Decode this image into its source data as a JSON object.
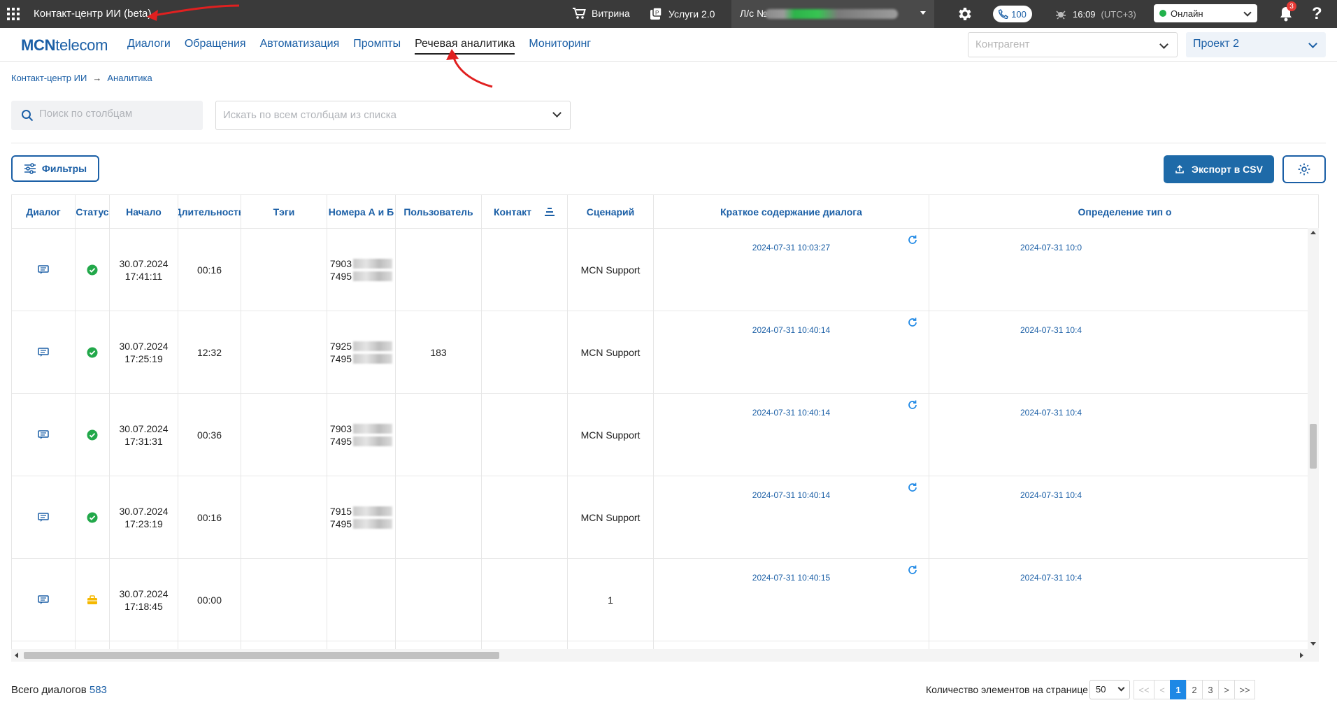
{
  "topbar": {
    "app_title": "Контакт-центр ИИ (beta)",
    "vitrina": "Витрина",
    "services": "Услуги 2.0",
    "account_label": "Л/с №",
    "calls_count": "100",
    "time": "16:09",
    "timezone": "(UTC+3)",
    "status": "Онлайн",
    "notifications": "3",
    "help": "?"
  },
  "nav": {
    "logo_bold": "MCN",
    "logo_rest": "telecom",
    "tabs": [
      "Диалоги",
      "Обращения",
      "Автоматизация",
      "Промпты",
      "Речевая аналитика",
      "Мониторинг"
    ],
    "active_tab": "Речевая аналитика",
    "contragent_placeholder": "Контрагент",
    "project": "Проект 2"
  },
  "breadcrumb": [
    "Контакт-центр ИИ",
    "Аналитика"
  ],
  "search": {
    "placeholder": "Поиск по столбцам",
    "all_columns_placeholder": "Искать по всем столбцам из списка"
  },
  "actions": {
    "filters": "Фильтры",
    "export": "Экспорт в CSV"
  },
  "table": {
    "columns": [
      "Диалог",
      "Статус",
      "Начало",
      "Длительность",
      "Тэги",
      "Номера А и Б",
      "Пользователь",
      "Контакт",
      "Сценарий",
      "Краткое содержание диалога",
      "Определение тип о"
    ],
    "rows": [
      {
        "status": "ok",
        "date": "30.07.2024",
        "time": "17:41:11",
        "duration": "00:16",
        "num_a": "7903",
        "num_b": "7495",
        "user": "",
        "scenario": "MCN Support",
        "summary_ts": "2024-07-31 10:03:27",
        "type_ts": "2024-07-31 10:0"
      },
      {
        "status": "ok",
        "date": "30.07.2024",
        "time": "17:25:19",
        "duration": "12:32",
        "num_a": "7925",
        "num_b": "7495",
        "user": "183",
        "scenario": "MCN Support",
        "summary_ts": "2024-07-31 10:40:14",
        "type_ts": "2024-07-31 10:4"
      },
      {
        "status": "ok",
        "date": "30.07.2024",
        "time": "17:31:31",
        "duration": "00:36",
        "num_a": "7903",
        "num_b": "7495",
        "user": "",
        "scenario": "MCN Support",
        "summary_ts": "2024-07-31 10:40:14",
        "type_ts": "2024-07-31 10:4"
      },
      {
        "status": "ok",
        "date": "30.07.2024",
        "time": "17:23:19",
        "duration": "00:16",
        "num_a": "7915",
        "num_b": "7495",
        "user": "",
        "scenario": "MCN Support",
        "summary_ts": "2024-07-31 10:40:14",
        "type_ts": "2024-07-31 10:4"
      },
      {
        "status": "briefcase",
        "date": "30.07.2024",
        "time": "17:18:45",
        "duration": "00:00",
        "num_a": "",
        "num_b": "",
        "user": "",
        "scenario": "1",
        "summary_ts": "2024-07-31 10:40:15",
        "type_ts": "2024-07-31 10:4"
      }
    ]
  },
  "footer": {
    "total_label": "Всего диалогов",
    "total_count": "583",
    "per_page_label": "Количество элементов на странице",
    "per_page": "50",
    "pages": [
      "<<",
      "<",
      "1",
      "2",
      "3",
      ">",
      ">>"
    ],
    "current_page": "1"
  },
  "colors": {
    "brand": "#1b5fa6",
    "topbar": "#3a3a3a",
    "success": "#22a84a",
    "warning": "#f5b800",
    "annotation_arrow": "#e02020"
  }
}
